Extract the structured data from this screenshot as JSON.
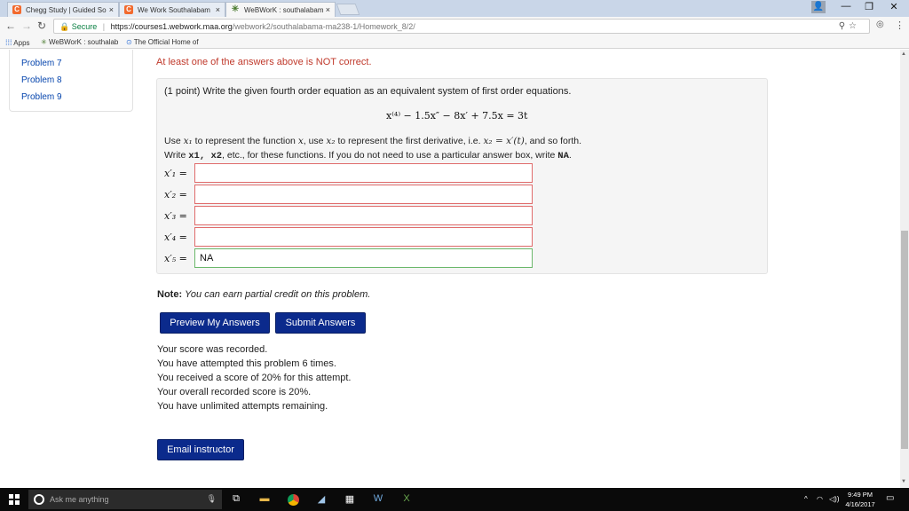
{
  "browser": {
    "tabs": [
      {
        "title": "Chegg Study | Guided So",
        "favicon": "chegg-icon",
        "color": "#f26a2e"
      },
      {
        "title": "We Work Southalabam",
        "favicon": "chegg-icon",
        "color": "#f26a2e"
      },
      {
        "title": "WeBWorK : southalabam",
        "favicon": "webwork-icon",
        "color": "#4a7b2f"
      }
    ],
    "tab_close": "×",
    "secure_label": "Secure",
    "url_host": "https://courses1.webwork.maa.org",
    "url_path": "/webwork2/southalabama-ma238-1/Homework_8/2/",
    "bookmarks": [
      {
        "label": "Apps",
        "icon": "apps-icon"
      },
      {
        "label": "WeBWorK : southalab",
        "icon": "webwork-icon"
      },
      {
        "label": "The Official Home of",
        "icon": "link-icon"
      }
    ]
  },
  "sidebar": {
    "items": [
      "Problem 7",
      "Problem 8",
      "Problem 9"
    ]
  },
  "warning": "At least one of the answers above is NOT correct.",
  "problem": {
    "intro": "(1 point) Write the given fourth order equation as an equivalent system of first order equations.",
    "equation": "x⁽⁴⁾ − 1.5x″ − 8x′ + 7.5x = 3t",
    "instr1_a": "Use ",
    "instr1_x1": "x₁",
    "instr1_b": " to represent the function ",
    "instr1_x": "x",
    "instr1_c": ", use ",
    "instr1_x2": "x₂",
    "instr1_d": " to represent the first derivative, i.e. ",
    "instr1_eq": "x₂ = x′(t)",
    "instr1_e": ", and so forth.",
    "instr2_a": "Write ",
    "instr2_code": "x1, x2",
    "instr2_b": ", etc., for these functions. If you do not need to use a particular answer box, write ",
    "instr2_na": "NA",
    "instr2_c": ".",
    "answers": [
      {
        "label": "x′₁ =",
        "value": ""
      },
      {
        "label": "x′₂ =",
        "value": ""
      },
      {
        "label": "x′₃ =",
        "value": ""
      },
      {
        "label": "x′₄ =",
        "value": ""
      },
      {
        "label": "x′₅ =",
        "value": "NA"
      }
    ]
  },
  "note_label": "Note:",
  "note_text": "You can earn partial credit on this problem.",
  "buttons": {
    "preview": "Preview My Answers",
    "submit": "Submit Answers",
    "email": "Email instructor"
  },
  "score_lines": [
    "Your score was recorded.",
    "You have attempted this problem 6 times.",
    "You received a score of 20% for this attempt.",
    "Your overall recorded score is 20%.",
    "You have unlimited attempts remaining."
  ],
  "taskbar": {
    "search_placeholder": "Ask me anything",
    "time": "9:49 PM",
    "date": "4/16/2017"
  }
}
